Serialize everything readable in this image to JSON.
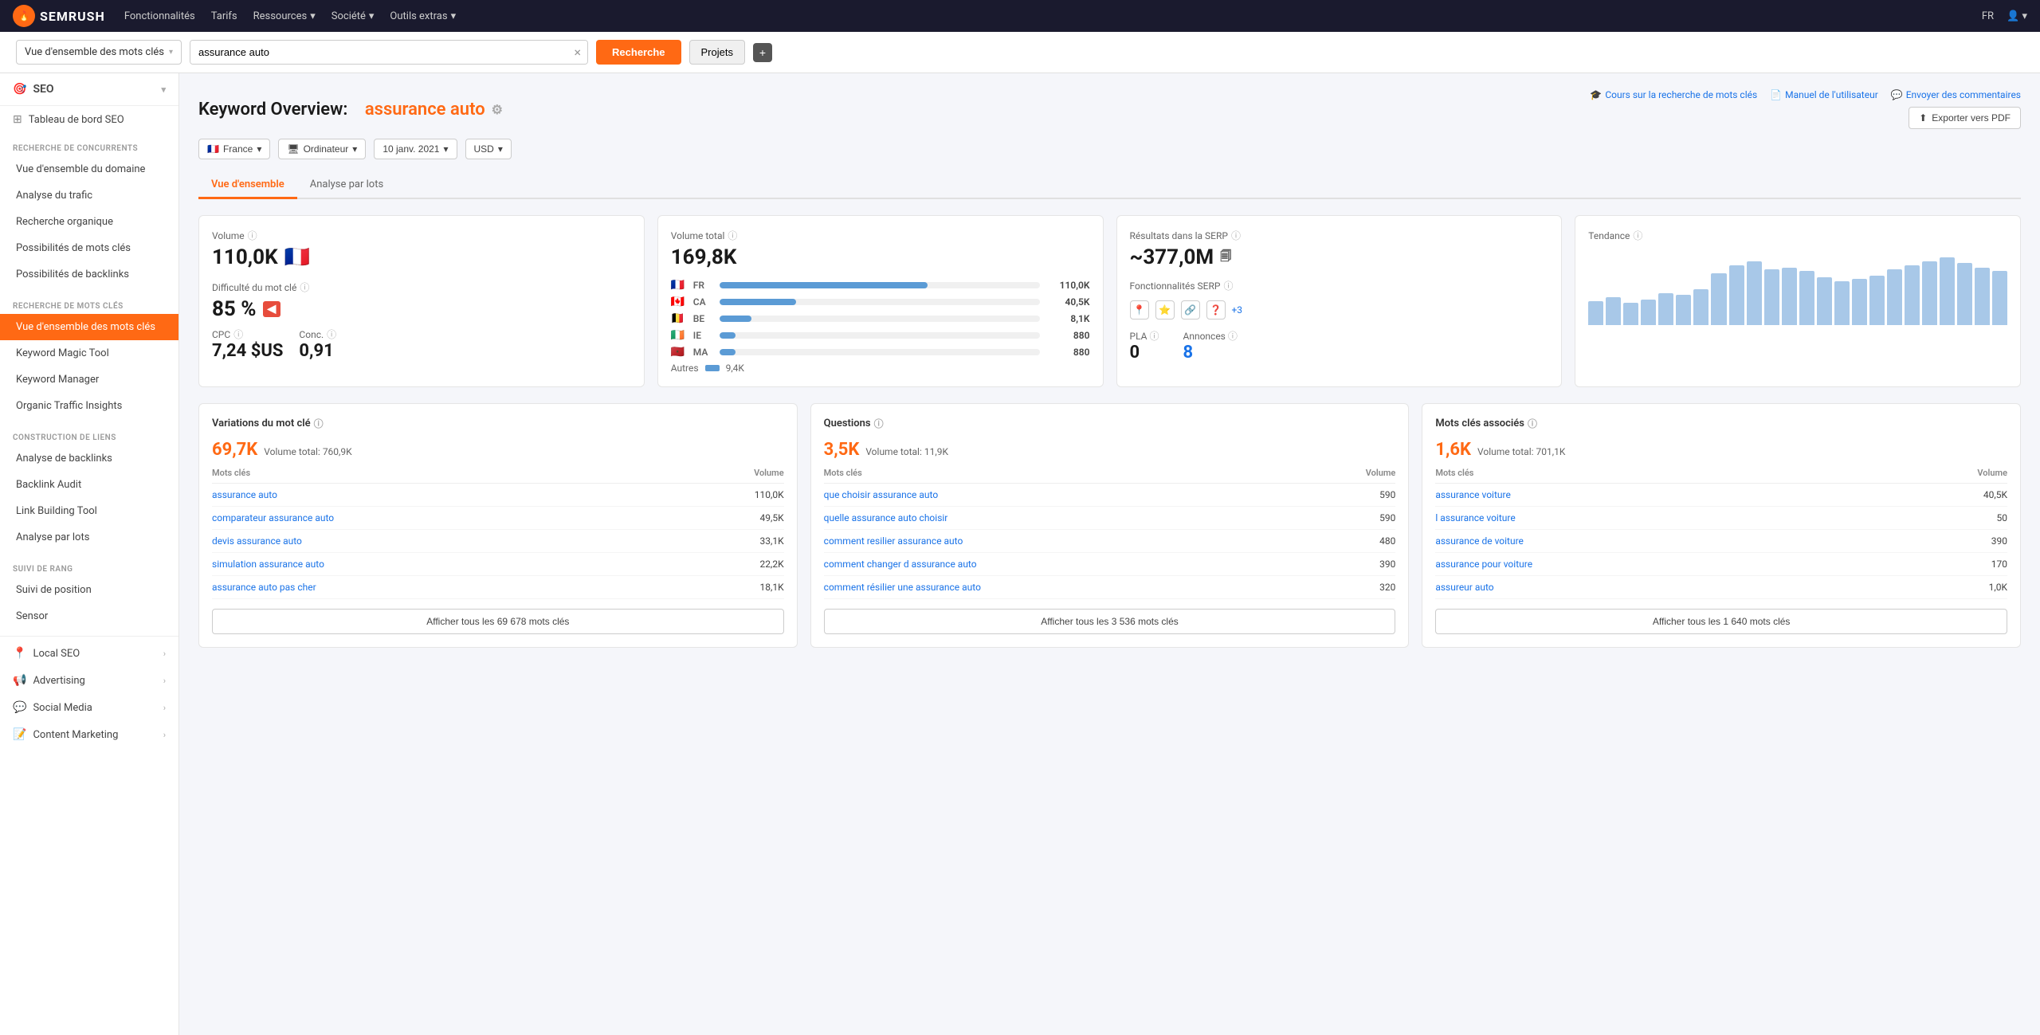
{
  "topnav": {
    "logo_text": "SEMRUSH",
    "logo_abbr": "S",
    "nav_items": [
      {
        "label": "Fonctionnalités"
      },
      {
        "label": "Tarifs"
      },
      {
        "label": "Ressources",
        "has_dropdown": true
      },
      {
        "label": "Société",
        "has_dropdown": true
      },
      {
        "label": "Outils extras",
        "has_dropdown": true
      }
    ],
    "lang": "FR",
    "user_icon": "👤"
  },
  "searchbar": {
    "dropdown_label": "Vue d'ensemble des mots clés",
    "input_value": "assurance auto",
    "search_btn": "Recherche",
    "projects_btn": "Projets",
    "plus_btn": "+"
  },
  "page": {
    "title_prefix": "Keyword Overview:",
    "keyword": "assurance auto",
    "links": [
      {
        "label": "Cours sur la recherche de mots clés",
        "icon": "🎓"
      },
      {
        "label": "Manuel de l'utilisateur",
        "icon": "📄"
      },
      {
        "label": "Envoyer des commentaires",
        "icon": "💬"
      }
    ],
    "export_btn": "Exporter vers PDF"
  },
  "filters": {
    "country": "France",
    "device": "Ordinateur",
    "date": "10 janv. 2021",
    "currency": "USD"
  },
  "tabs": [
    {
      "label": "Vue d'ensemble",
      "active": true
    },
    {
      "label": "Analyse par lots",
      "active": false
    }
  ],
  "cards": {
    "volume": {
      "label": "Volume",
      "value": "110,0K",
      "flag": "🇫🇷"
    },
    "volume_total": {
      "label": "Volume total",
      "value": "169,8K",
      "rows": [
        {
          "flag": "🇫🇷",
          "country": "FR",
          "value": "110,0K",
          "pct": 65
        },
        {
          "flag": "🇨🇦",
          "country": "CA",
          "value": "40,5K",
          "pct": 24
        },
        {
          "flag": "🇧🇪",
          "country": "BE",
          "value": "8,1K",
          "pct": 10
        },
        {
          "flag": "🇮🇪",
          "country": "IE",
          "value": "880",
          "pct": 5
        },
        {
          "flag": "🇲🇦",
          "country": "MA",
          "value": "880",
          "pct": 5
        }
      ],
      "others_label": "Autres",
      "others_value": "9,4K"
    },
    "serp": {
      "label": "Résultats dans la SERP",
      "value": "~377,0M",
      "features_label": "Fonctionnalités SERP",
      "features": [
        "📍",
        "⭐",
        "🔗",
        "❓"
      ],
      "more": "+3",
      "pla_label": "PLA",
      "pla_value": "0",
      "annonces_label": "Annonces",
      "annonces_value": "8"
    },
    "tendance": {
      "label": "Tendance",
      "bars": [
        30,
        35,
        28,
        32,
        40,
        38,
        45,
        65,
        75,
        80,
        70,
        72,
        68,
        60,
        55,
        58,
        62,
        70,
        75,
        80,
        85,
        78,
        72,
        68
      ]
    },
    "difficulty": {
      "label": "Difficulté du mot clé",
      "value": "85 %"
    },
    "cpc": {
      "label": "CPC",
      "value": "7,24 $US"
    },
    "conc": {
      "label": "Conc.",
      "value": "0,91"
    }
  },
  "kw_sections": {
    "variations": {
      "title": "Variations du mot clé",
      "count": "69,7K",
      "vol_total_label": "Volume total:",
      "vol_total": "760,9K",
      "col_kw": "Mots clés",
      "col_vol": "Volume",
      "rows": [
        {
          "kw": "assurance auto",
          "vol": "110,0K"
        },
        {
          "kw": "comparateur assurance auto",
          "vol": "49,5K"
        },
        {
          "kw": "devis assurance auto",
          "vol": "33,1K"
        },
        {
          "kw": "simulation assurance auto",
          "vol": "22,2K"
        },
        {
          "kw": "assurance auto pas cher",
          "vol": "18,1K"
        }
      ],
      "show_all_btn": "Afficher tous les 69 678 mots clés"
    },
    "questions": {
      "title": "Questions",
      "count": "3,5K",
      "vol_total_label": "Volume total:",
      "vol_total": "11,9K",
      "col_kw": "Mots clés",
      "col_vol": "Volume",
      "rows": [
        {
          "kw": "que choisir assurance auto",
          "vol": "590"
        },
        {
          "kw": "quelle assurance auto choisir",
          "vol": "590"
        },
        {
          "kw": "comment resilier assurance auto",
          "vol": "480"
        },
        {
          "kw": "comment changer d assurance auto",
          "vol": "390"
        },
        {
          "kw": "comment résilier une assurance auto",
          "vol": "320"
        }
      ],
      "show_all_btn": "Afficher tous les 3 536 mots clés"
    },
    "associated": {
      "title": "Mots clés associés",
      "count": "1,6K",
      "vol_total_label": "Volume total:",
      "vol_total": "701,1K",
      "col_kw": "Mots clés",
      "col_vol": "Volume",
      "rows": [
        {
          "kw": "assurance voiture",
          "vol": "40,5K"
        },
        {
          "kw": "l assurance voiture",
          "vol": "50"
        },
        {
          "kw": "assurance de voiture",
          "vol": "390"
        },
        {
          "kw": "assurance pour voiture",
          "vol": "170"
        },
        {
          "kw": "assureur auto",
          "vol": "1,0K"
        }
      ],
      "show_all_btn": "Afficher tous les 1 640 mots clés"
    }
  },
  "sidebar": {
    "seo_label": "SEO",
    "dashboard_label": "Tableau de bord SEO",
    "sections": [
      {
        "title": "RECHERCHE DE CONCURRENTS",
        "items": [
          "Vue d'ensemble du domaine",
          "Analyse du trafic",
          "Recherche organique",
          "Possibilités de mots clés",
          "Possibilités de backlinks"
        ]
      },
      {
        "title": "RECHERCHE DE MOTS CLÉS",
        "items": [
          "Vue d'ensemble des mots clés",
          "Keyword Magic Tool",
          "Keyword Manager",
          "Organic Traffic Insights"
        ]
      },
      {
        "title": "CONSTRUCTION DE LIENS",
        "items": [
          "Analyse de backlinks",
          "Backlink Audit",
          "Link Building Tool",
          "Analyse par lots"
        ]
      },
      {
        "title": "SUIVI DE RANG",
        "items": [
          "Suivi de position",
          "Sensor"
        ]
      }
    ],
    "bottom_items": [
      {
        "label": "Local SEO"
      },
      {
        "label": "Advertising"
      },
      {
        "label": "Social Media"
      },
      {
        "label": "Content Marketing"
      }
    ]
  }
}
